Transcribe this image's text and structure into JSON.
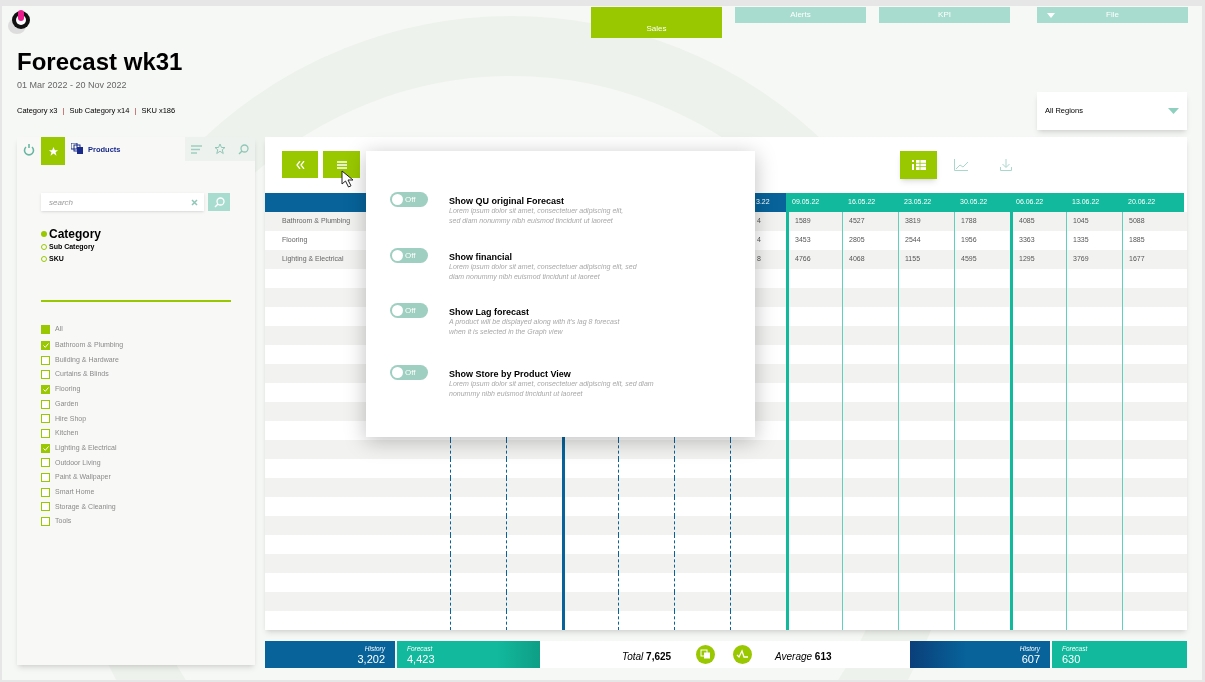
{
  "header": {
    "title": "Forecast wk31",
    "date_range": "01 Mar 2022 - 20 Nov 2022",
    "counts": [
      "Category x3",
      "Sub Category x14",
      "SKU x186"
    ],
    "separators": [
      "|",
      "|"
    ]
  },
  "nav_tabs": [
    {
      "label": "Sales",
      "selected": true,
      "dropdown": false
    },
    {
      "label": "Alerts",
      "selected": false,
      "dropdown": false
    },
    {
      "label": "KPI",
      "selected": false,
      "dropdown": false
    },
    {
      "label": "File",
      "selected": false,
      "dropdown": true
    }
  ],
  "region_select": {
    "value": "All Regions"
  },
  "sidebar": {
    "title": "Products",
    "search": {
      "placeholder": "search"
    },
    "levels": [
      {
        "label": "Category",
        "selected": true
      },
      {
        "label": "Sub Category",
        "selected": false
      },
      {
        "label": "SKU",
        "selected": false
      }
    ],
    "filters": [
      {
        "label": "All",
        "kind": "all",
        "checked": true
      },
      {
        "label": "Bathroom & Plumbing",
        "kind": "item",
        "checked": true
      },
      {
        "label": "Building & Hardware",
        "kind": "item",
        "checked": false
      },
      {
        "label": "Curtains & Blinds",
        "kind": "item",
        "checked": false
      },
      {
        "label": "Flooring",
        "kind": "item",
        "checked": true
      },
      {
        "label": "Garden",
        "kind": "item",
        "checked": false
      },
      {
        "label": "Hire Shop",
        "kind": "item",
        "checked": false
      },
      {
        "label": "Kitchen",
        "kind": "item",
        "checked": false
      },
      {
        "label": "Lighting & Electrical",
        "kind": "item",
        "checked": true
      },
      {
        "label": "Outdoor Living",
        "kind": "item",
        "checked": false
      },
      {
        "label": "Paint & Wallpaper",
        "kind": "item",
        "checked": false
      },
      {
        "label": "Smart Home",
        "kind": "item",
        "checked": false
      },
      {
        "label": "Storage & Cleaning",
        "kind": "item",
        "checked": false
      },
      {
        "label": "Tools",
        "kind": "item",
        "checked": false
      }
    ]
  },
  "view_buttons": [
    {
      "kind": "table",
      "selected": true
    },
    {
      "kind": "chart",
      "selected": false
    },
    {
      "kind": "download",
      "selected": false
    }
  ],
  "table": {
    "column_groups": [
      {
        "kind": "history",
        "columns": [
          null,
          null,
          null,
          null,
          null,
          "3.22"
        ]
      },
      {
        "kind": "forecast",
        "columns": [
          "09.05.22",
          "16.05.22",
          "23.05.22",
          "30.05.22",
          "06.06.22",
          "13.06.22",
          "20.06.22"
        ]
      }
    ],
    "rows": [
      {
        "name": "Bathroom & Plumbing",
        "cells": [
          null,
          null,
          null,
          null,
          null,
          "4",
          "1589",
          "4527",
          "3819",
          "1788",
          "4085",
          "1045",
          "5088"
        ]
      },
      {
        "name": "Flooring",
        "cells": [
          null,
          null,
          null,
          null,
          null,
          "4",
          "3453",
          "2805",
          "2544",
          "1956",
          "3363",
          "1335",
          "1885"
        ]
      },
      {
        "name": "Lighting & Electrical",
        "cells": [
          null,
          null,
          null,
          null,
          null,
          "8",
          "4766",
          "4068",
          "1155",
          "4595",
          "1295",
          "3769",
          "1677"
        ]
      }
    ]
  },
  "settings_popup": {
    "options": [
      {
        "title": "Show QU original Forecast",
        "description": "Lorem ipsum dolor sit amet, consectetuer adipiscing elit,\nsed diam nonummy nibh euismod tincidunt ut laoreet",
        "on": false,
        "state_label": "Off"
      },
      {
        "title": "Show financial",
        "description": "Lorem ipsum dolor sit amet, consectetuer adipiscing elit, sed\ndiam nonummy nibh euismod tincidunt ut laoreet",
        "on": false,
        "state_label": "Off"
      },
      {
        "title": "Show Lag forecast",
        "description": "A product will be displayed along with it's lag 8 forecast\nwhen it is selected in the Graph view",
        "on": false,
        "state_label": "Off"
      },
      {
        "title": "Show Store by Product View",
        "description": "Lorem ipsum dolor sit amet, consectetuer adipiscing elit, sed diam\nnonummy nibh euismod tincidunt ut laoreet",
        "on": false,
        "state_label": "Off"
      }
    ]
  },
  "summary": {
    "left_history": {
      "label": "History",
      "value": "3,202"
    },
    "left_forecast": {
      "label": "Forecast",
      "value": "4,423"
    },
    "total": "*Total* **7,625**",
    "average": "*Average* **613**",
    "right_history": {
      "label": "History",
      "value": "607"
    },
    "right_forecast": {
      "label": "Forecast",
      "value": "630"
    }
  }
}
